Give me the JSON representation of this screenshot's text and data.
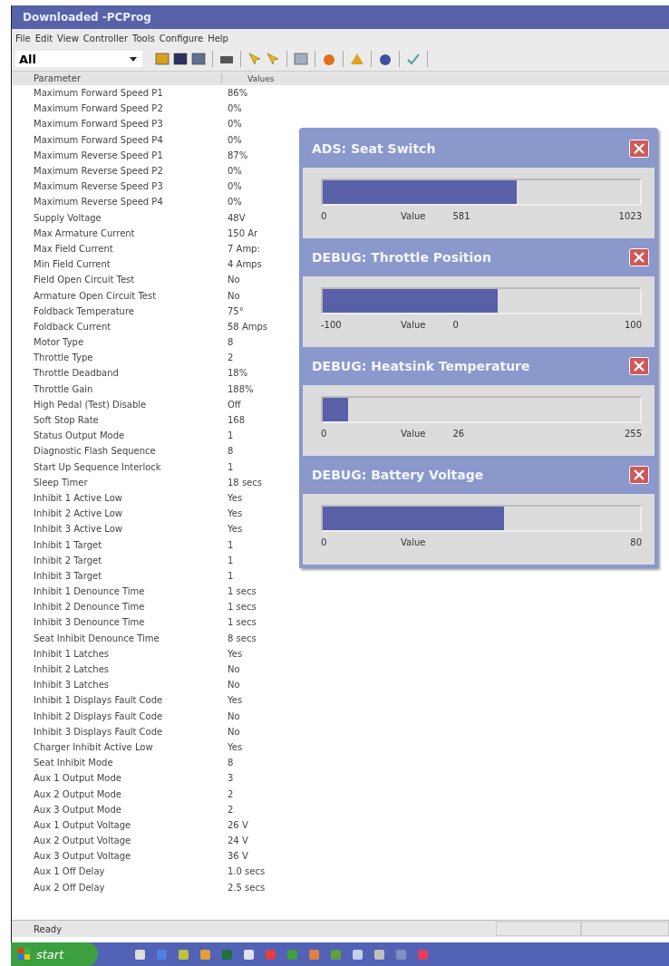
{
  "window": {
    "title": "Downloaded -PCProg"
  },
  "menu": [
    "File",
    "Edit",
    "View",
    "Controller",
    "Tools",
    "Configure",
    "Help"
  ],
  "toolbar": {
    "filter": "All",
    "icons": [
      {
        "kind": "open"
      },
      {
        "kind": "save"
      },
      {
        "kind": "grid"
      },
      {
        "kind": "print"
      },
      {
        "kind": "arrow"
      },
      {
        "kind": "arrow"
      },
      {
        "kind": "page"
      },
      {
        "kind": "flame"
      },
      {
        "kind": "warning"
      },
      {
        "kind": "drop"
      },
      {
        "kind": "check"
      }
    ]
  },
  "table": {
    "columns": [
      "Parameter",
      "Values"
    ],
    "rows": [
      [
        "Maximum Forward Speed P1",
        "86%"
      ],
      [
        "Maximum Forward Speed P2",
        "0%"
      ],
      [
        "Maximum Forward Speed P3",
        "0%"
      ],
      [
        "Maximum Forward Speed P4",
        "0%"
      ],
      [
        "Maximum Reverse Speed P1",
        "87%"
      ],
      [
        "Maximum Reverse Speed P2",
        "0%"
      ],
      [
        "Maximum Reverse Speed P3",
        "0%"
      ],
      [
        "Maximum Reverse Speed P4",
        "0%"
      ],
      [
        "Supply Voltage",
        "48V"
      ],
      [
        "Max Armature Current",
        "150 Ar"
      ],
      [
        "Max Field Current",
        "7 Amp:"
      ],
      [
        "Min Field Current",
        "4 Amps"
      ],
      [
        "Field Open Circuit Test",
        "No"
      ],
      [
        "Armature Open Circuit Test",
        "No"
      ],
      [
        "Foldback Temperature",
        "75°"
      ],
      [
        "Foldback Current",
        "58 Amps"
      ],
      [
        "Motor Type",
        "8"
      ],
      [
        "Throttle Type",
        "2"
      ],
      [
        "Throttle Deadband",
        "18%"
      ],
      [
        "Throttle Gain",
        "188%"
      ],
      [
        "High Pedal (Test) Disable",
        "Off"
      ],
      [
        "Soft Stop Rate",
        "168"
      ],
      [
        "Status Output Mode",
        "1"
      ],
      [
        "Diagnostic Flash Sequence",
        "8"
      ],
      [
        "Start Up Sequence Interlock",
        "1"
      ],
      [
        "Sleep Timer",
        "18 secs"
      ],
      [
        "Inhibit 1 Active Low",
        "Yes"
      ],
      [
        "Inhibit 2 Active Low",
        "Yes"
      ],
      [
        "Inhibit 3 Active Low",
        "Yes"
      ],
      [
        "Inhibit 1 Target",
        "1"
      ],
      [
        "Inhibit 2 Target",
        "1"
      ],
      [
        "Inhibit 3 Target",
        "1"
      ],
      [
        "Inhibit 1 Denounce Time",
        "1 secs"
      ],
      [
        "Inhibit 2 Denounce Time",
        "1 secs"
      ],
      [
        "Inhibit 3 Denounce Time",
        "1 secs"
      ],
      [
        "Seat Inhibit Denounce Time",
        "8 secs"
      ],
      [
        "Inhibit 1 Latches",
        "Yes"
      ],
      [
        "Inhibit 2 Latches",
        "No"
      ],
      [
        "Inhibit 3 Latches",
        "No"
      ],
      [
        "Inhibit 1 Displays Fault Code",
        "Yes"
      ],
      [
        "Inhibit 2 Displays Fault Code",
        "No"
      ],
      [
        "Inhibit 3 Displays Fault Code",
        "No"
      ],
      [
        "Charger Inhibit Active Low",
        "Yes"
      ],
      [
        "Seat Inhibit Mode",
        "8"
      ],
      [
        "Aux 1 Output Mode",
        "3"
      ],
      [
        "Aux 2 Output Mode",
        "2"
      ],
      [
        "Aux 3 Output Mode",
        "2"
      ],
      [
        "Aux 1 Output Voltage",
        "26 V"
      ],
      [
        "Aux 2 Output Voltage",
        "24 V"
      ],
      [
        "Aux 3 Output Voltage",
        "36 V"
      ],
      [
        "Aux 1 Off Delay",
        "1.0 secs"
      ],
      [
        "Aux 2 Off Delay",
        "2.5 secs"
      ]
    ]
  },
  "monitors": [
    {
      "title": "ADS: Seat Switch",
      "level": 0.61,
      "min": "0",
      "label": "Value",
      "reading": "581",
      "max": "1023"
    },
    {
      "title": "DEBUG: Throttle Position",
      "level": 0.55,
      "min": "-100",
      "label": "Value",
      "reading": "0",
      "max": "100"
    },
    {
      "title": "DEBUG: Heatsink Temperature",
      "level": 0.08,
      "min": "0",
      "label": "Value",
      "reading": "26",
      "max": "255"
    },
    {
      "title": "DEBUG: Battery Voltage",
      "level": 0.57,
      "min": "0",
      "label": "Value",
      "max": "80"
    }
  ],
  "status_bar": {
    "text": "Ready"
  },
  "taskbar": {
    "start": "start"
  }
}
